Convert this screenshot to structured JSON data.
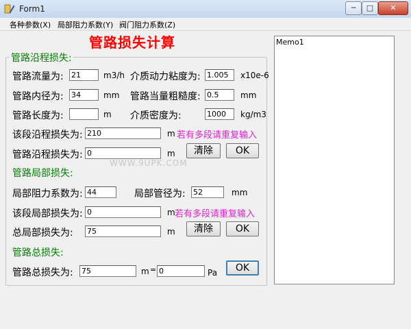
{
  "window": {
    "title": "Form1",
    "min": "─",
    "max": "□",
    "close": "✕"
  },
  "menu": [
    "各种参数(X)",
    "局部阻力系数(Y)",
    "阀门阻力系数(Z)"
  ],
  "main_title": "管路损失计算",
  "friction": {
    "section": "管路沿程损失:",
    "flow_label": "管路流量为:",
    "flow_value": "21",
    "flow_unit": "m3/h",
    "visc_label": "介质动力粘度为:",
    "visc_value": "1.005",
    "visc_unit": "x10e-6",
    "diam_label": "管路内径为:",
    "diam_value": "34",
    "diam_unit": "mm",
    "rough_label": "管路当量粗糙度:",
    "rough_value": "0.5",
    "rough_unit": "mm",
    "len_label": "管路长度为:",
    "len_value": "",
    "len_unit": "m",
    "dens_label": "介质密度为:",
    "dens_value": "1000",
    "dens_unit": "kg/m3",
    "seg_label": "该段沿程损失为:",
    "seg_value": "210",
    "seg_unit": "m",
    "hint": "若有多段请重复输入",
    "total_label": "管路沿程损失为:",
    "total_value": "0",
    "total_unit": "m",
    "clear": "清除",
    "ok": "OK"
  },
  "local": {
    "section": "管路局部损失:",
    "coef_label": "局部阻力系数为:",
    "coef_value": "44",
    "pipe_label": "局部管径为:",
    "pipe_value": "52",
    "pipe_unit": "mm",
    "seg_label": "该段局部损失为:",
    "seg_value": "0",
    "seg_unit": "m",
    "hint": "若有多段请重复输入",
    "total_label": "总局部损失为:",
    "total_value": "75",
    "total_unit": "m",
    "clear": "清除",
    "ok": "OK"
  },
  "overall": {
    "section": "管路总损失:",
    "label": "管路总损失为:",
    "value_m": "75",
    "unit_m": "m",
    "eq": "=",
    "value_pa": "0",
    "unit_pa": "Pa",
    "ok": "OK"
  },
  "memo": {
    "text": "Memo1"
  },
  "watermark": "WWW.9UPK.COM"
}
